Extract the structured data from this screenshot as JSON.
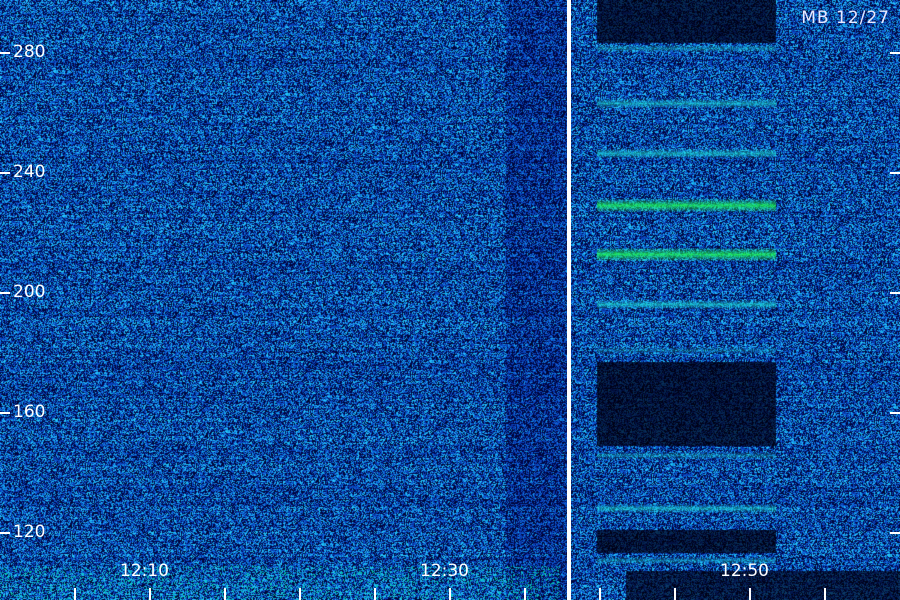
{
  "caption": "MB 12/27",
  "y_axis": {
    "labels": [
      "280",
      "240",
      "200",
      "160",
      "120"
    ]
  },
  "x_axis": {
    "labels": [
      "12:10",
      "12:30",
      "12:50"
    ]
  },
  "colors": {
    "background": "#0a1a6e",
    "noise_low": "#000018",
    "noise_mid": "#1a3cc8",
    "noise_high": "#2aa0ff",
    "band_cyan": "#1ad8d0",
    "band_green": "#20f060",
    "divider": "#ffffff",
    "text": "#ffffff"
  }
}
